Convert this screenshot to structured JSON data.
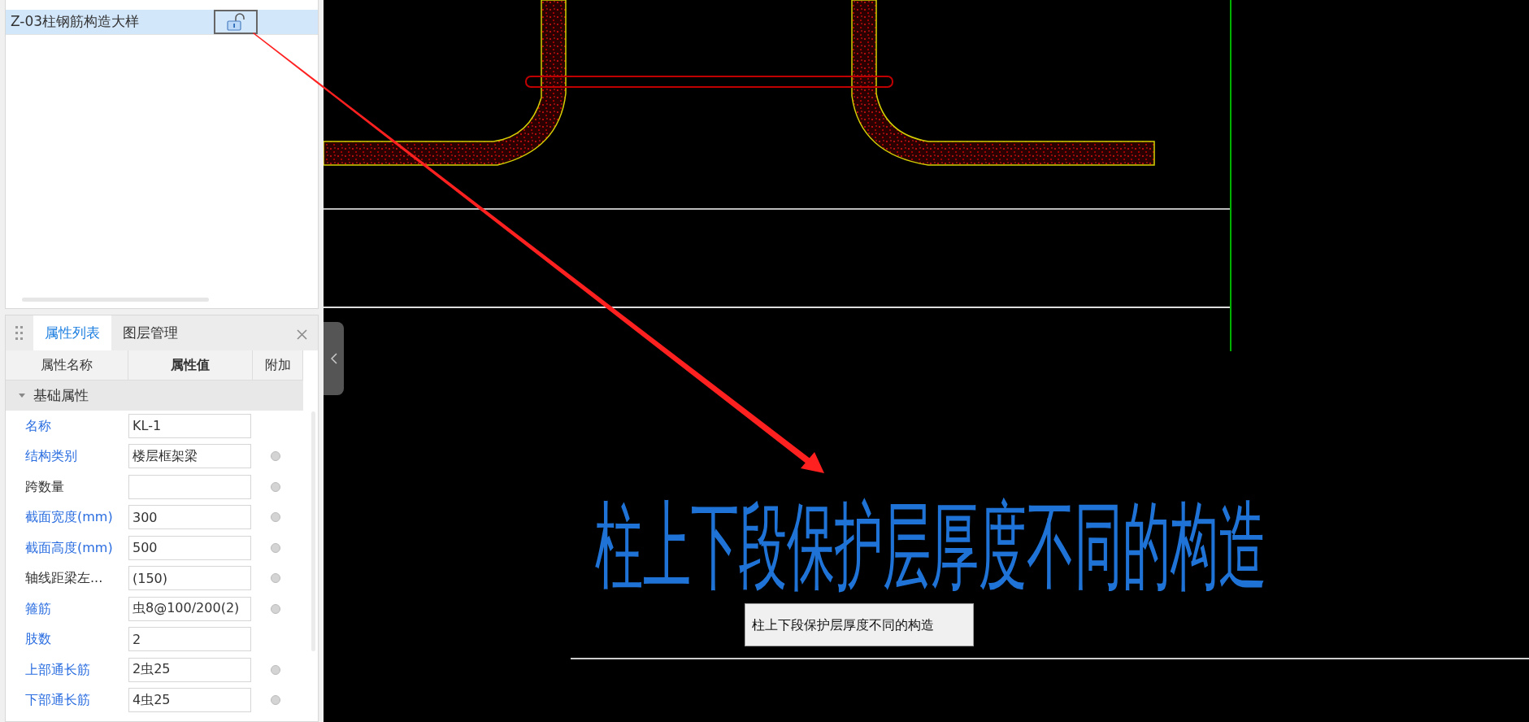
{
  "layers": {
    "rows": [
      {
        "label": "Z-03柱钢筋构造大样",
        "selected": true,
        "locked": false
      }
    ]
  },
  "properties": {
    "tabs": [
      {
        "label": "属性列表",
        "selected": true
      },
      {
        "label": "图层管理",
        "selected": false
      }
    ],
    "columns": [
      "属性名称",
      "属性值",
      "附加"
    ],
    "group": {
      "label": "基础属性",
      "expanded": true
    },
    "rows": [
      {
        "name": "名称",
        "value": "KL-1",
        "required": true,
        "attachable": false
      },
      {
        "name": "结构类别",
        "value": "楼层框架梁",
        "required": true,
        "attachable": true
      },
      {
        "name": "跨数量",
        "required": false,
        "attachable": true
      },
      {
        "name": "截面宽度(mm)",
        "value": "300",
        "required": true,
        "attachable": true
      },
      {
        "name": "截面高度(mm)",
        "value": "500",
        "required": true,
        "attachable": true
      },
      {
        "name": "轴线距梁左...",
        "value": "(150)",
        "required": false,
        "attachable": true
      },
      {
        "name": "箍筋",
        "value": "虫8@100/200(2)",
        "required": true,
        "attachable": true
      },
      {
        "name": "肢数",
        "value": "2",
        "required": true,
        "attachable": false
      },
      {
        "name": "上部通长筋",
        "value": "2虫25",
        "required": true,
        "attachable": true
      },
      {
        "name": "下部通长筋",
        "value": "4虫25",
        "required": true,
        "attachable": true
      }
    ]
  },
  "canvas": {
    "drawing_text": "柱上下段保护层厚度不同的构造",
    "tooltip": "柱上下段保护层厚度不同的构造"
  }
}
